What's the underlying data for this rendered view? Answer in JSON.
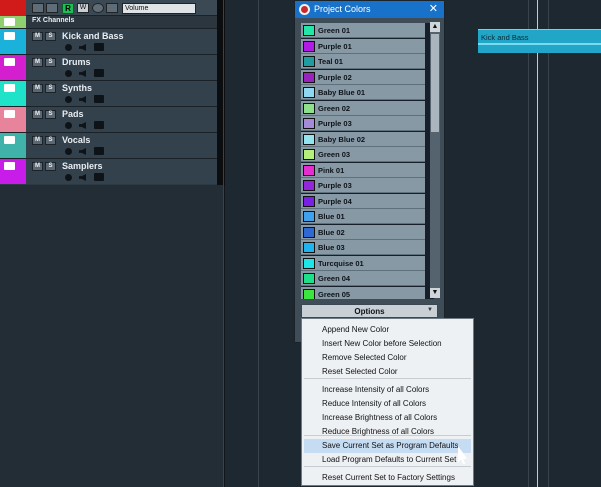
{
  "toolbar": {
    "r_label": "R",
    "w_label": "W",
    "volume_label": "Volume",
    "red": "#d11a1a"
  },
  "fx_channels": {
    "label": "FX Channels",
    "color": "#8ecf6f"
  },
  "tracks": [
    {
      "name": "Kick and Bass",
      "color": "#1ab1da"
    },
    {
      "name": "Drums",
      "color": "#d31fd0"
    },
    {
      "name": "Synths",
      "color": "#1fe3c9"
    },
    {
      "name": "Pads",
      "color": "#e8839c"
    },
    {
      "name": "Vocals",
      "color": "#3fb2aa"
    },
    {
      "name": "Samplers",
      "color": "#c81ce8"
    }
  ],
  "track_buttons": {
    "mute": "M",
    "solo": "S"
  },
  "event": {
    "label": "Kick and Bass",
    "color": "#22a6c8"
  },
  "dialog": {
    "title": "Project Colors",
    "close": "✕",
    "colors": [
      {
        "name": "Green 01",
        "color": "#23e6a9"
      },
      {
        "name": "Purple 01",
        "color": "#b21ae6"
      },
      {
        "name": "Teal 01",
        "color": "#1f9da0"
      },
      {
        "name": "Purple 02",
        "color": "#9a23bf"
      },
      {
        "name": "Baby Blue 01",
        "color": "#8fd8f2"
      },
      {
        "name": "Green 02",
        "color": "#8fe08a"
      },
      {
        "name": "Purple 03",
        "color": "#a48ad7"
      },
      {
        "name": "Baby Blue 02",
        "color": "#93e4ee"
      },
      {
        "name": "Green 03",
        "color": "#b4f07c"
      },
      {
        "name": "Pink 01",
        "color": "#e62ed0"
      },
      {
        "name": "Purple 03",
        "color": "#9326d9"
      },
      {
        "name": "Purple 04",
        "color": "#7a1fe6"
      },
      {
        "name": "Blue 01",
        "color": "#3fa0ec"
      },
      {
        "name": "Blue 02",
        "color": "#2e69d1"
      },
      {
        "name": "Blue 03",
        "color": "#1fb4f0"
      },
      {
        "name": "Turcquise 01",
        "color": "#1de6e8"
      },
      {
        "name": "Green 04",
        "color": "#1fe08a"
      },
      {
        "name": "Green 05",
        "color": "#3de63f"
      }
    ],
    "options_label": "Options"
  },
  "menu": [
    {
      "label": "Append New Color",
      "selected": false
    },
    {
      "label": "Insert New Color before Selection",
      "selected": false
    },
    {
      "label": "Remove Selected Color",
      "selected": false
    },
    {
      "label": "Reset Selected Color",
      "selected": false
    },
    {
      "label": "Increase Intensity of all Colors",
      "selected": false
    },
    {
      "label": "Reduce Intensity of all Colors",
      "selected": false
    },
    {
      "label": "Increase Brightness of all Colors",
      "selected": false
    },
    {
      "label": "Reduce Brightness of all Colors",
      "selected": false
    },
    {
      "label": "Save Current Set as Program Defaults",
      "selected": true
    },
    {
      "label": "Load Program Defaults to Current Set",
      "selected": false
    },
    {
      "label": "Reset Current Set to Factory Settings",
      "selected": false
    }
  ]
}
